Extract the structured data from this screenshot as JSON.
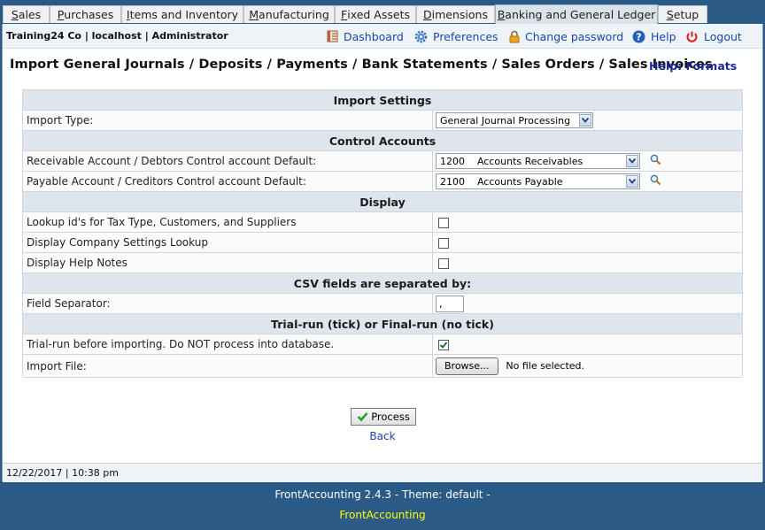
{
  "tabs": [
    {
      "underline": "S",
      "rest": "ales"
    },
    {
      "underline": "P",
      "rest": "urchases"
    },
    {
      "underline": "I",
      "rest": "tems and Inventory"
    },
    {
      "underline": "M",
      "rest": "anufacturing"
    },
    {
      "underline": "F",
      "rest": "ixed Assets"
    },
    {
      "underline": "D",
      "rest": "imensions"
    },
    {
      "underline": "B",
      "rest": "anking and General Ledger"
    },
    {
      "underline": "S",
      "rest": "etup"
    }
  ],
  "header": {
    "company": "Training24 Co | localhost | Administrator",
    "links": {
      "dashboard": "Dashboard",
      "preferences": "Preferences",
      "change_password": "Change password",
      "help": "Help",
      "logout": "Logout"
    }
  },
  "page": {
    "title": "Import General Journals / Deposits / Payments / Bank Statements / Sales Orders / Sales Invoices",
    "help_link": "Help: Formats"
  },
  "form": {
    "sections": {
      "import_settings": "Import Settings",
      "control_accounts": "Control Accounts",
      "display": "Display",
      "csv": "CSV fields are separated by:",
      "trial": "Trial-run (tick) or Final-run (no tick)"
    },
    "import_type": {
      "label": "Import Type:",
      "value": "General Journal Processing"
    },
    "receivable": {
      "label": "Receivable Account / Debtors Control account Default:",
      "value": "1200    Accounts Receivables"
    },
    "payable": {
      "label": "Payable Account / Creditors Control account Default:",
      "value": "2100    Accounts Payable"
    },
    "lookup_ids": {
      "label": "Lookup id's for Tax Type, Customers, and Suppliers",
      "checked": false
    },
    "company_lookup": {
      "label": "Display Company Settings Lookup",
      "checked": false
    },
    "help_notes": {
      "label": "Display Help Notes",
      "checked": false
    },
    "field_separator": {
      "label": "Field Separator:",
      "value": ","
    },
    "trial_run": {
      "label": "Trial-run before importing. Do NOT process into database.",
      "checked": true
    },
    "import_file": {
      "label": "Import File:",
      "button": "Browse...",
      "status": "No file selected."
    }
  },
  "actions": {
    "process": "Process",
    "back": "Back"
  },
  "status_bar": {
    "text": "12/22/2017 | 10:38 pm"
  },
  "footer": {
    "version": "FrontAccounting 2.4.3 - Theme: default -",
    "brand": "FrontAccounting"
  },
  "colors": {
    "background": "#2c5a86",
    "link": "#1a47a8",
    "footer_brand": "#ffff00"
  }
}
